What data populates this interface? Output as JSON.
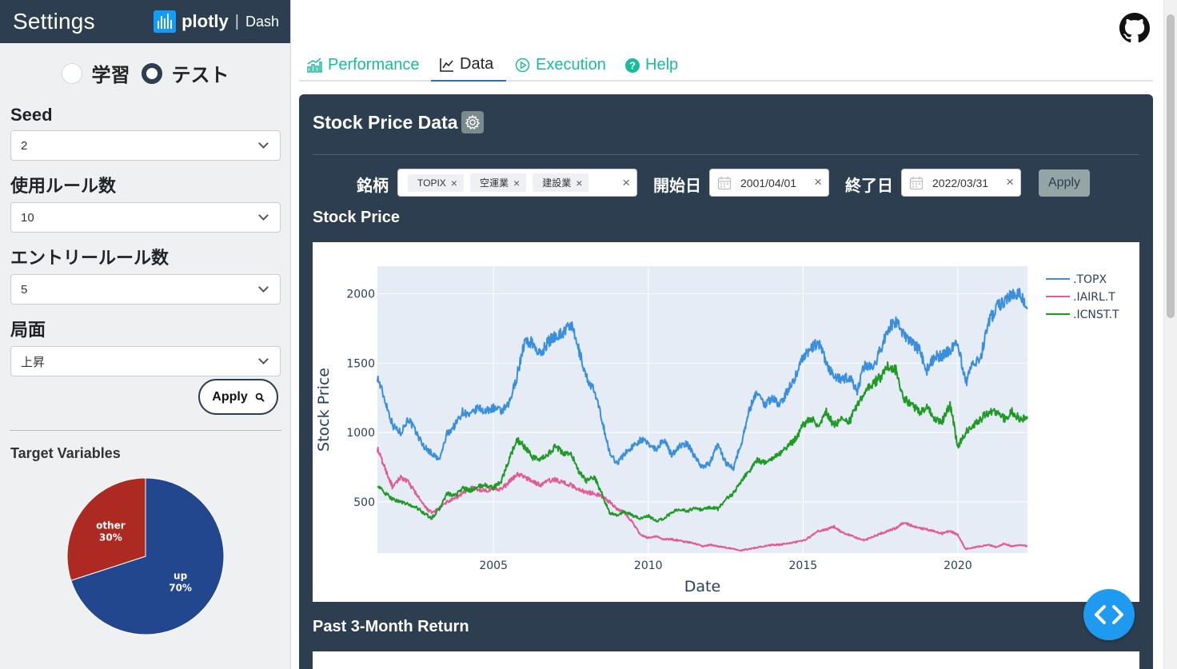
{
  "sidebar": {
    "title": "Settings",
    "brand": {
      "name": "plotly",
      "product": "Dash",
      "logo_color": "#119dff"
    },
    "mode": {
      "options": [
        "学習",
        "テスト"
      ],
      "selected": "テスト"
    },
    "fields": [
      {
        "label": "Seed",
        "value": "2"
      },
      {
        "label": "使用ルール数",
        "value": "10"
      },
      {
        "label": "エントリールール数",
        "value": "5"
      },
      {
        "label": "局面",
        "value": "上昇"
      }
    ],
    "apply_label": "Apply",
    "target_title": "Target Variables",
    "pie": {
      "type": "pie",
      "labels": [
        "up",
        "other"
      ],
      "values": [
        70,
        30
      ],
      "pct_labels": [
        "70%",
        "30%"
      ],
      "colors": [
        "#22478f",
        "#ad2a22"
      ]
    }
  },
  "tabs": [
    {
      "label": "Performance",
      "icon": "bar-chart-icon"
    },
    {
      "label": "Data",
      "icon": "line-chart-icon",
      "active": true
    },
    {
      "label": "Execution",
      "icon": "play-circle-icon"
    },
    {
      "label": "Help",
      "icon": "question-circle-icon"
    }
  ],
  "panel": {
    "title": "Stock Price Data",
    "filters": {
      "ticker_label": "銘柄",
      "tickers": [
        "TOPIX",
        "空運業",
        "建設業"
      ],
      "start_label": "開始日",
      "start_date": "2001/04/01",
      "end_label": "終了日",
      "end_date": "2022/03/31",
      "apply_label": "Apply"
    },
    "section1_title": "Stock Price",
    "section2_title": "Past 3-Month Return"
  },
  "chart_data": {
    "type": "line",
    "xlabel": "Date",
    "ylabel": "Stock Price",
    "xlim": [
      2001.25,
      2022.25
    ],
    "ylim": [
      130,
      2200
    ],
    "x_ticks": [
      2005,
      2010,
      2015,
      2020
    ],
    "y_ticks": [
      500,
      1000,
      1500,
      2000
    ],
    "legend_position": "top-right",
    "grid": true,
    "series": [
      {
        "name": ".TOPX",
        "color": "#3a8fdc",
        "x": [
          2001.25,
          2001.5,
          2001.75,
          2002.0,
          2002.25,
          2002.5,
          2002.75,
          2003.0,
          2003.25,
          2003.5,
          2003.75,
          2004.0,
          2004.25,
          2004.5,
          2004.75,
          2005.0,
          2005.25,
          2005.5,
          2005.75,
          2006.0,
          2006.25,
          2006.5,
          2006.75,
          2007.0,
          2007.25,
          2007.5,
          2007.75,
          2008.0,
          2008.25,
          2008.5,
          2008.75,
          2009.0,
          2009.25,
          2009.5,
          2009.75,
          2010.0,
          2010.25,
          2010.5,
          2010.75,
          2011.0,
          2011.25,
          2011.5,
          2011.75,
          2012.0,
          2012.25,
          2012.5,
          2012.75,
          2013.0,
          2013.25,
          2013.5,
          2013.75,
          2014.0,
          2014.25,
          2014.5,
          2014.75,
          2015.0,
          2015.25,
          2015.5,
          2015.75,
          2016.0,
          2016.25,
          2016.5,
          2016.75,
          2017.0,
          2017.25,
          2017.5,
          2017.75,
          2018.0,
          2018.25,
          2018.5,
          2018.75,
          2019.0,
          2019.25,
          2019.5,
          2019.75,
          2020.0,
          2020.25,
          2020.5,
          2020.75,
          2021.0,
          2021.25,
          2021.5,
          2021.75,
          2022.0,
          2022.25
        ],
        "y": [
          1400,
          1230,
          1050,
          1000,
          1100,
          1000,
          900,
          850,
          800,
          990,
          1050,
          1150,
          1120,
          1180,
          1150,
          1180,
          1150,
          1200,
          1400,
          1650,
          1650,
          1560,
          1650,
          1700,
          1720,
          1780,
          1600,
          1400,
          1300,
          1100,
          850,
          780,
          850,
          900,
          950,
          920,
          880,
          950,
          840,
          900,
          920,
          830,
          750,
          780,
          920,
          780,
          750,
          920,
          1150,
          1300,
          1200,
          1250,
          1200,
          1300,
          1400,
          1550,
          1600,
          1650,
          1500,
          1400,
          1380,
          1400,
          1300,
          1500,
          1450,
          1600,
          1750,
          1800,
          1700,
          1650,
          1600,
          1450,
          1550,
          1550,
          1600,
          1650,
          1350,
          1500,
          1550,
          1800,
          1900,
          1950,
          2000,
          2000,
          1900
        ]
      },
      {
        "name": ".IAIRL.T",
        "color": "#e05c96",
        "x": [
          2001.25,
          2001.5,
          2001.75,
          2002.0,
          2002.25,
          2002.5,
          2002.75,
          2003.0,
          2003.25,
          2003.5,
          2003.75,
          2004.0,
          2004.25,
          2004.5,
          2004.75,
          2005.0,
          2005.25,
          2005.5,
          2005.75,
          2006.0,
          2006.25,
          2006.5,
          2006.75,
          2007.0,
          2007.25,
          2007.5,
          2007.75,
          2008.0,
          2008.25,
          2008.5,
          2008.75,
          2009.0,
          2009.25,
          2009.5,
          2009.75,
          2010.0,
          2010.25,
          2010.5,
          2010.75,
          2011.0,
          2011.25,
          2011.5,
          2011.75,
          2012.0,
          2012.25,
          2012.5,
          2012.75,
          2013.0,
          2013.25,
          2013.5,
          2013.75,
          2014.0,
          2014.25,
          2014.5,
          2014.75,
          2015.0,
          2015.25,
          2015.5,
          2015.75,
          2016.0,
          2016.25,
          2016.5,
          2016.75,
          2017.0,
          2017.25,
          2017.5,
          2017.75,
          2018.0,
          2018.25,
          2018.5,
          2018.75,
          2019.0,
          2019.25,
          2019.5,
          2019.75,
          2020.0,
          2020.25,
          2020.5,
          2020.75,
          2021.0,
          2021.25,
          2021.5,
          2021.75,
          2022.0,
          2022.25
        ],
        "y": [
          880,
          740,
          600,
          680,
          640,
          560,
          470,
          420,
          450,
          500,
          520,
          560,
          600,
          590,
          580,
          600,
          590,
          640,
          700,
          680,
          650,
          620,
          650,
          660,
          640,
          620,
          590,
          570,
          560,
          540,
          500,
          450,
          420,
          350,
          260,
          240,
          250,
          230,
          230,
          220,
          210,
          200,
          180,
          190,
          180,
          170,
          160,
          150,
          160,
          170,
          180,
          190,
          190,
          200,
          210,
          220,
          250,
          290,
          300,
          320,
          280,
          260,
          240,
          220,
          250,
          270,
          290,
          310,
          350,
          330,
          310,
          300,
          290,
          270,
          290,
          260,
          160,
          170,
          180,
          190,
          170,
          200,
          180,
          190,
          180
        ]
      },
      {
        "name": ".ICNST.T",
        "color": "#1f9a24",
        "x": [
          2001.25,
          2001.5,
          2001.75,
          2002.0,
          2002.25,
          2002.5,
          2002.75,
          2003.0,
          2003.25,
          2003.5,
          2003.75,
          2004.0,
          2004.25,
          2004.5,
          2004.75,
          2005.0,
          2005.25,
          2005.5,
          2005.75,
          2006.0,
          2006.25,
          2006.5,
          2006.75,
          2007.0,
          2007.25,
          2007.5,
          2007.75,
          2008.0,
          2008.25,
          2008.5,
          2008.75,
          2009.0,
          2009.25,
          2009.5,
          2009.75,
          2010.0,
          2010.25,
          2010.5,
          2010.75,
          2011.0,
          2011.25,
          2011.5,
          2011.75,
          2012.0,
          2012.25,
          2012.5,
          2012.75,
          2013.0,
          2013.25,
          2013.5,
          2013.75,
          2014.0,
          2014.25,
          2014.5,
          2014.75,
          2015.0,
          2015.25,
          2015.5,
          2015.75,
          2016.0,
          2016.25,
          2016.5,
          2016.75,
          2017.0,
          2017.25,
          2017.5,
          2017.75,
          2018.0,
          2018.25,
          2018.5,
          2018.75,
          2019.0,
          2019.25,
          2019.5,
          2019.75,
          2020.0,
          2020.25,
          2020.5,
          2020.75,
          2021.0,
          2021.25,
          2021.5,
          2021.75,
          2022.0,
          2022.25
        ],
        "y": [
          620,
          560,
          520,
          500,
          480,
          460,
          420,
          380,
          450,
          560,
          540,
          600,
          580,
          610,
          620,
          600,
          650,
          800,
          950,
          900,
          820,
          800,
          840,
          900,
          850,
          850,
          720,
          650,
          680,
          560,
          420,
          400,
          430,
          400,
          380,
          400,
          360,
          380,
          420,
          450,
          430,
          460,
          440,
          460,
          450,
          520,
          560,
          650,
          720,
          800,
          780,
          820,
          850,
          900,
          950,
          1050,
          1100,
          1050,
          1150,
          1050,
          1100,
          1080,
          1200,
          1300,
          1350,
          1400,
          1480,
          1450,
          1250,
          1200,
          1150,
          1180,
          1100,
          1080,
          1200,
          900,
          1000,
          1050,
          1100,
          1150,
          1150,
          1100,
          1150,
          1100,
          1100
        ]
      }
    ]
  }
}
